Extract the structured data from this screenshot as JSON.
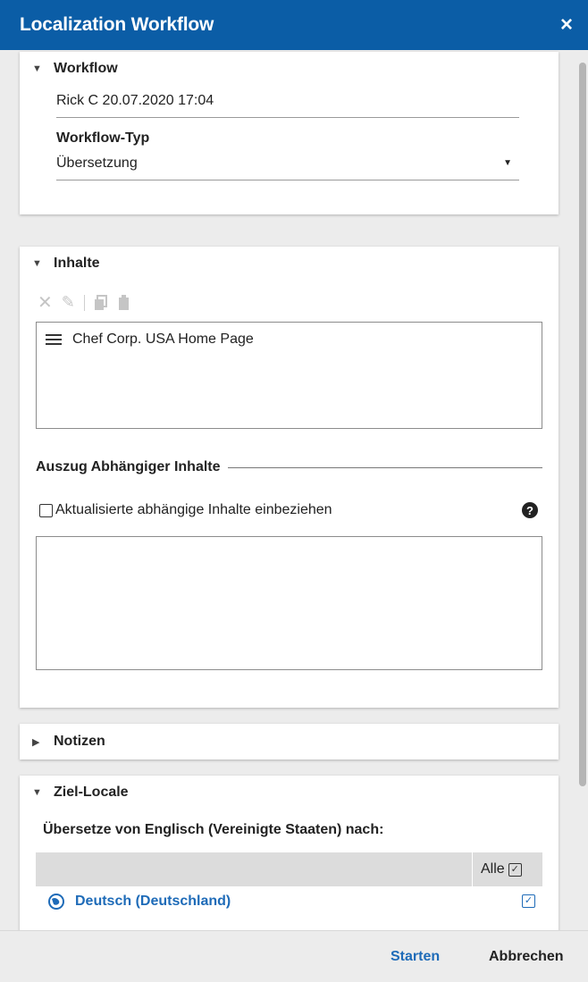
{
  "window": {
    "title": "Localization Workflow",
    "close": "×"
  },
  "workflow": {
    "heading": "Workflow",
    "name_value": "Rick C 20.07.2020 17:04",
    "type_label": "Workflow-Typ",
    "type_value": "Übersetzung"
  },
  "inhalte": {
    "heading": "Inhalte",
    "items": [
      "Chef Corp. USA Home Page"
    ],
    "dependent_section_label": "Auszug Abhängiger Inhalte",
    "include_updated_label": "Aktualisierte abhängige Inhalte einbeziehen"
  },
  "notizen": {
    "heading": "Notizen"
  },
  "ziel_locale": {
    "heading": "Ziel-Locale",
    "translate_from": "Übersetze von Englisch (Vereinigte Staaten) nach:",
    "all_label": "Alle",
    "locales": [
      {
        "name": "Deutsch (Deutschland)",
        "checked": true
      }
    ]
  },
  "footer": {
    "start_label": "Starten",
    "cancel_label": "Abbrechen"
  },
  "colors": {
    "header_bg": "#0b5da6",
    "accent": "#1e6bb8"
  }
}
